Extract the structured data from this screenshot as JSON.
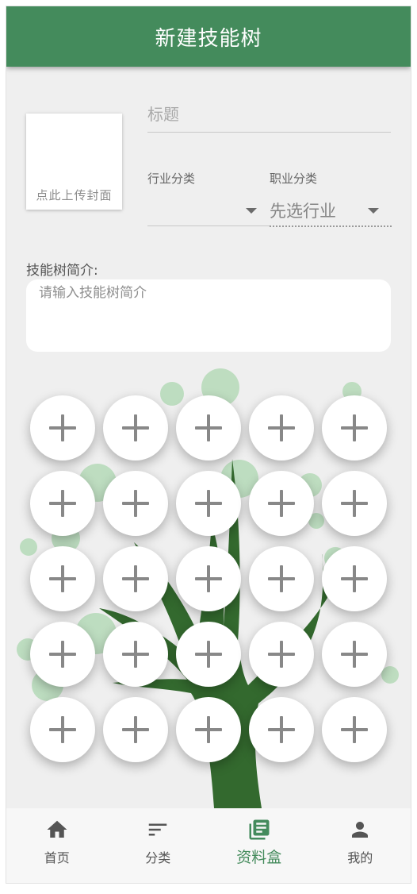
{
  "appbar": {
    "title": "新建技能树"
  },
  "cover": {
    "label": "点此上传封面"
  },
  "form": {
    "title_placeholder": "标题",
    "industry": {
      "label": "行业分类",
      "value": ""
    },
    "career": {
      "label": "职业分类",
      "value": "先选行业"
    },
    "intro_label": "技能树简介:",
    "intro_placeholder": "请输入技能树简介"
  },
  "skill_nodes": {
    "rows": 5,
    "columns": 5,
    "icon": "plus-icon"
  },
  "bottom_nav": [
    {
      "label": "首页",
      "icon": "home-icon",
      "active": false
    },
    {
      "label": "分类",
      "icon": "sort-icon",
      "active": false
    },
    {
      "label": "资料盒",
      "icon": "library-books-icon",
      "active": true
    },
    {
      "label": "我的",
      "icon": "person-icon",
      "active": false
    }
  ],
  "colors": {
    "primary": "#448b5c",
    "background": "#efefef",
    "tree_trunk": "#33692e",
    "foliage": "#a9d6ad"
  }
}
